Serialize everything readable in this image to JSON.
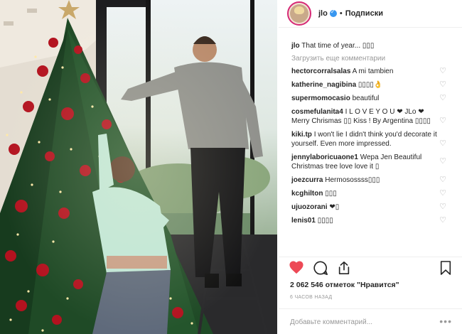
{
  "post": {
    "username": "jlo",
    "follow_label": "Подписки",
    "caption_user": "jlo",
    "caption_text": "That time of year... ▯▯▯",
    "load_more": "Загрузить еще комментарии",
    "likes": "2 062 546 отметок \"Нравится\"",
    "time": "6 ЧАСОВ НАЗАД",
    "add_comment_placeholder": "Добавьте комментарий...",
    "more": "•••"
  },
  "comments": [
    {
      "user": "hectorcorralsalas",
      "text": "A mi tambien"
    },
    {
      "user": "katherine_nagibina",
      "text": "▯▯▯▯👌"
    },
    {
      "user": "supermomocasio",
      "text": "beautiful"
    },
    {
      "user": "cosmefulanita4",
      "text": "I L O V E Y O U ❤ JLo ❤ Merry Chrismas ▯▯ Kiss ! By Argentina ▯▯▯▯"
    },
    {
      "user": "kiki.tp",
      "text": "I won't lie I didn't think you'd decorate it yourself. Even more impressed."
    },
    {
      "user": "jennylaboricuaone1",
      "text": "Wepa Jen Beautiful Christmas tree love love it ▯"
    },
    {
      "user": "joezcurra",
      "text": "Hermosossss▯▯▯"
    },
    {
      "user": "kcghilton",
      "text": "▯▯▯"
    },
    {
      "user": "ujuozorani",
      "text": "❤▯"
    },
    {
      "user": "lenis01",
      "text": "▯▯▯▯"
    }
  ],
  "icons": {
    "like": "heart-icon",
    "comment": "comment-icon",
    "share": "share-icon",
    "save": "bookmark-icon",
    "verified": "verified-badge-icon"
  },
  "colors": {
    "like_red": "#ed4956",
    "verified_blue": "#3897f0",
    "muted_text": "#999999"
  }
}
